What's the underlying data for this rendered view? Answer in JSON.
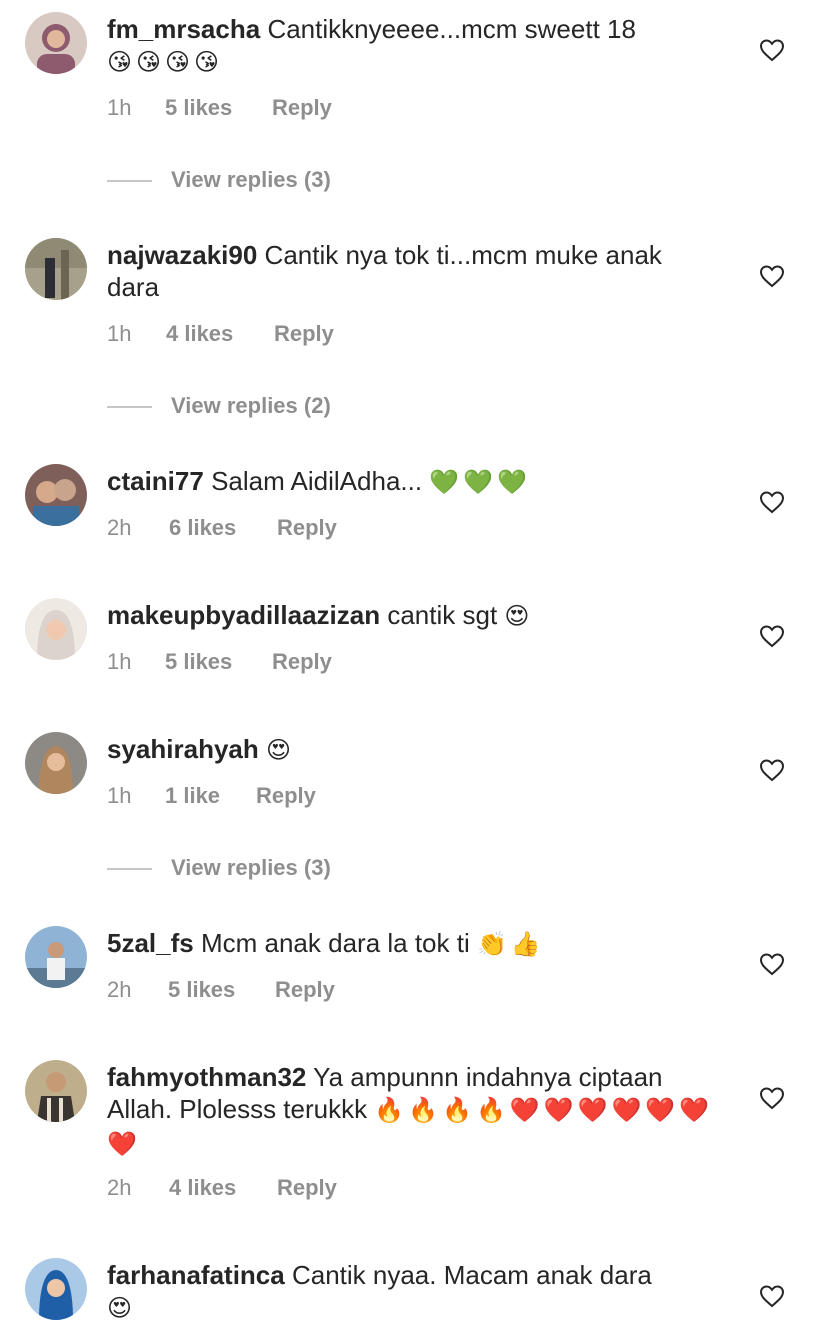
{
  "comments": [
    {
      "username": "fm_mrsacha",
      "text": "Cantikknyeeee...mcm sweett 18",
      "emoji": "😘😘😘😘",
      "time": "1h",
      "likes": "5 likes",
      "reply": "Reply",
      "view_replies": "View replies (3)",
      "avatar_color": "#8e5a6e"
    },
    {
      "username": "najwazaki90",
      "text": "Cantik nya tok ti...mcm muke anak dara",
      "emoji": "",
      "time": "1h",
      "likes": "4 likes",
      "reply": "Reply",
      "view_replies": "View replies (2)",
      "avatar_color": "#7a7360"
    },
    {
      "username": "ctaini77",
      "text": "Salam AidilAdha...",
      "emoji": "💚💚💚",
      "time": "2h",
      "likes": "6 likes",
      "reply": "Reply",
      "view_replies": "",
      "avatar_color": "#6a4a46"
    },
    {
      "username": "makeupbyadillaazizan",
      "text": "cantik sgt",
      "emoji": "😍",
      "time": "1h",
      "likes": "5 likes",
      "reply": "Reply",
      "view_replies": "",
      "avatar_color": "#d9cfc8"
    },
    {
      "username": "syahirahyah",
      "text": "",
      "emoji": "😍",
      "time": "1h",
      "likes": "1 like",
      "reply": "Reply",
      "view_replies": "View replies (3)",
      "avatar_color": "#9a7a62"
    },
    {
      "username": "5zal_fs",
      "text": "Mcm anak dara la tok ti",
      "emoji": "👏👍",
      "time": "2h",
      "likes": "5 likes",
      "reply": "Reply",
      "view_replies": "",
      "avatar_color": "#6f95b8"
    },
    {
      "username": "fahmyothman32",
      "text": "Ya ampunnn indahnya ciptaan Allah. Plolesss terukkk",
      "emoji": "🔥🔥🔥🔥❤️❤️❤️❤️❤️❤️❤️",
      "time": "2h",
      "likes": "4 likes",
      "reply": "Reply",
      "view_replies": "",
      "avatar_color": "#8a7a5c"
    },
    {
      "username": "farhanafatinca",
      "text": "Cantik nyaa. Macam anak dara",
      "emoji": "😍",
      "time": "",
      "likes": "",
      "reply": "",
      "view_replies": "",
      "avatar_color": "#2f6fb0"
    }
  ],
  "colors": {
    "text": "#262626",
    "meta": "#8e8e8e",
    "line": "#c7c7c7"
  },
  "icons": {
    "like": "heart-outline-icon"
  }
}
